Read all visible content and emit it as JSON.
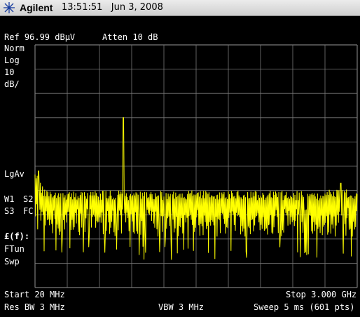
{
  "header": {
    "brand": "Agilent",
    "time": "13:51:51",
    "date": "Jun 3, 2008",
    "icon": "agilent-spark-icon"
  },
  "settings": {
    "ref_level": "Ref 96.99 dBμV",
    "atten": "Atten 10 dB",
    "detector_mode": "Norm",
    "scale_type": "Log",
    "scale_value": "10",
    "scale_unit": "dB/",
    "averaging": "LgAv",
    "trace_w1": "W1",
    "trace_s2": "S2",
    "trace_s3": "S3",
    "trace_fc": "FC",
    "corr": "£(f):",
    "ftun": "FTun",
    "swp": "Swp"
  },
  "footer": {
    "start": "Start 20 MHz",
    "stop": "Stop 3.000 GHz",
    "res_bw": "Res BW 3 MHz",
    "vbw": "VBW 3 MHz",
    "sweep": "Sweep 5 ms (601 pts)"
  },
  "colors": {
    "background": "#000000",
    "grid": "#7a7a7a",
    "trace": "#ffff00",
    "text": "#ffffff"
  },
  "chart_data": {
    "type": "line",
    "title": "",
    "xlabel": "",
    "ylabel": "",
    "x_unit": "MHz",
    "y_unit": "dBμV",
    "xlim": [
      20,
      3000
    ],
    "ylim": [
      -3.01,
      96.99
    ],
    "grid": true,
    "legend": "none",
    "series": [
      {
        "values_note_free": true,
        "x": [
          20,
          50,
          100,
          200,
          300,
          500,
          800,
          845,
          870,
          880,
          900,
          950,
          1200,
          1500,
          1800,
          2100,
          2400,
          2700,
          2850,
          3000
        ],
        "noise_band_top": [
          46,
          42,
          38,
          37,
          37,
          37,
          37,
          37,
          37,
          37,
          37,
          37,
          37,
          37,
          37,
          37,
          37,
          37,
          38,
          37
        ],
        "noise_band_bottom": [
          17,
          18,
          18,
          18,
          18,
          18,
          18,
          18,
          18,
          18,
          18,
          18,
          18,
          18,
          18,
          18,
          18,
          18,
          18,
          18
        ],
        "peaks": [
          {
            "x": 835,
            "y": 67
          },
          {
            "x": 50,
            "y": 45
          },
          {
            "x": 2850,
            "y": 40
          }
        ]
      }
    ]
  }
}
